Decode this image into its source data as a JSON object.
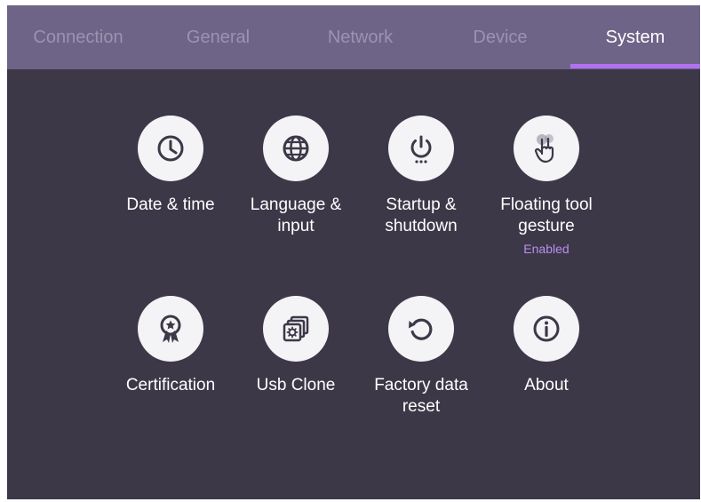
{
  "tabs": [
    {
      "label": "Connection"
    },
    {
      "label": "General"
    },
    {
      "label": "Network"
    },
    {
      "label": "Device"
    },
    {
      "label": "System",
      "active": true
    }
  ],
  "items": [
    {
      "label": "Date & time",
      "icon": "clock-icon"
    },
    {
      "label": "Language &\ninput",
      "icon": "globe-icon"
    },
    {
      "label": "Startup &\nshutdown",
      "icon": "power-icon"
    },
    {
      "label": "Floating tool\ngesture",
      "icon": "gesture-hand-icon",
      "status": "Enabled"
    },
    {
      "label": "Certification",
      "icon": "award-ribbon-icon"
    },
    {
      "label": "Usb Clone",
      "icon": "usb-clone-icon"
    },
    {
      "label": "Factory data\nreset",
      "icon": "reset-icon"
    },
    {
      "label": "About",
      "icon": "info-icon"
    }
  ],
  "colors": {
    "tab_bar": "#6e6488",
    "background": "#3d3848",
    "accent": "#b072f0",
    "status_text": "#b88ef0"
  }
}
